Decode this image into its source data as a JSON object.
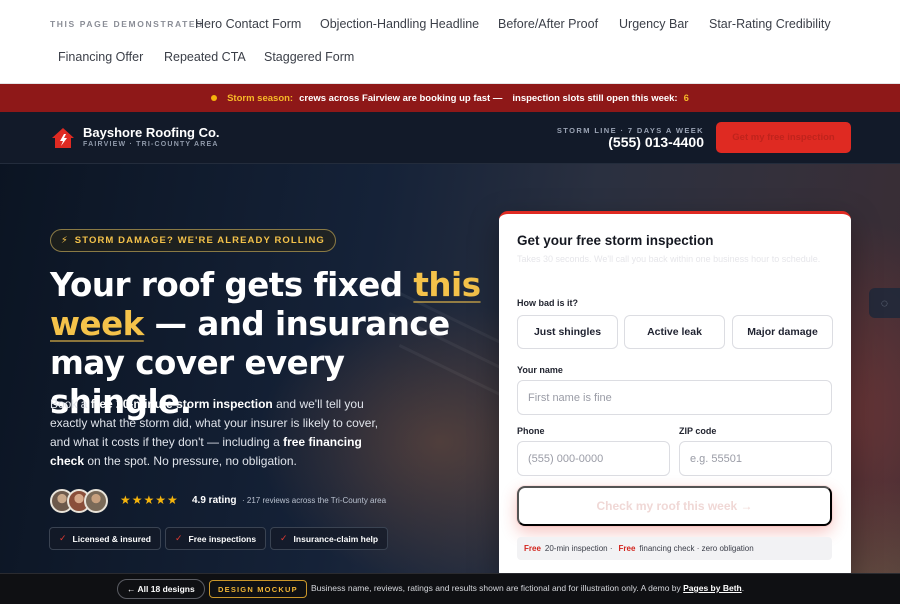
{
  "demo_nav": {
    "label": "THIS PAGE DEMONSTRATES",
    "links": [
      "Hero Contact Form",
      "Objection-Handling Headline",
      "Before/After Proof",
      "Urgency Bar",
      "Star-Rating Credibility",
      "Financing Offer",
      "Repeated CTA",
      "Staggered Form"
    ]
  },
  "urgency": {
    "lead": "Storm season:",
    "text": "crews across Fairview are booking up fast —",
    "slots_text": "inspection slots still open this week:",
    "slots": "6"
  },
  "header": {
    "brand_name": "Bayshore Roofing Co.",
    "brand_sub": "FAIRVIEW · TRI-COUNTY AREA",
    "storm_line": "STORM LINE · 7 DAYS A WEEK",
    "phone": "(555) 013-4400",
    "cta": "Get my free inspection"
  },
  "hero": {
    "badge": "STORM DAMAGE? WE'RE ALREADY ROLLING",
    "headline_a": "Your roof gets fixed ",
    "headline_hl": "this week",
    "headline_b": " — and insurance may cover every shingle.",
    "sub_1": "Book a ",
    "sub_b1": "free 20-minute storm inspection",
    "sub_2": " and we'll tell you exactly what the storm did, what your insurer is likely to cover, and what it costs if they don't — including a ",
    "sub_b2": "free financing check",
    "sub_3": " on the spot. No pressure, no obligation.",
    "stars": "★★★★★",
    "rating": "4.9 rating",
    "reviews": "· 217 reviews across the Tri-County area",
    "chips": [
      "Licensed & insured",
      "Free inspections",
      "Insurance-claim help"
    ]
  },
  "form": {
    "title": "Get your free storm inspection",
    "subtitle": "Takes 30 seconds. We'll call you back within one business hour to schedule.",
    "severity_label": "How bad is it?",
    "severity_options": [
      "Just shingles",
      "Active leak",
      "Major damage"
    ],
    "name_label": "Your name",
    "name_placeholder": "First name is fine",
    "phone_label": "Phone",
    "phone_placeholder": "(555) 000-0000",
    "zip_label": "ZIP code",
    "zip_placeholder": "e.g. 55501",
    "submit": "Check my roof this week →",
    "note_free_1": "Free",
    "note_text_1": "20-min inspection ·",
    "note_free_2": "Free",
    "note_text_2": "financing check · zero obligation"
  },
  "footer": {
    "back": "← All 18 designs",
    "badge": "DESIGN MOCKUP",
    "disclaimer": "Business name, reviews, ratings and results shown are fictional and for illustration only. A demo by ",
    "author": "Pages by Beth",
    "end": "."
  },
  "colors": {
    "accent_red": "#df2a22",
    "urgency_bg": "#8e1818",
    "gold": "#f4c24a",
    "star": "#f5b40c"
  }
}
